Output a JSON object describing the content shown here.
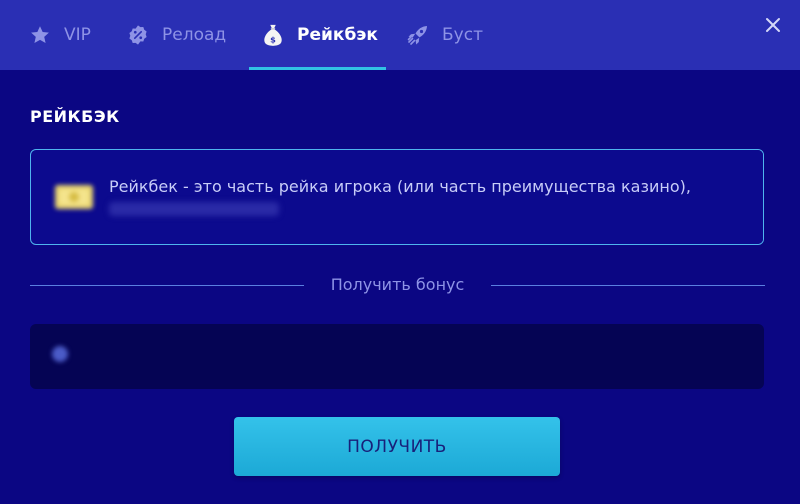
{
  "tabs": [
    {
      "label": "VIP",
      "icon": "star-icon"
    },
    {
      "label": "Релоад",
      "icon": "percent-badge-icon"
    },
    {
      "label": "Рейкбэк",
      "icon": "money-bag-icon",
      "active": true
    },
    {
      "label": "Буст",
      "icon": "rocket-icon"
    }
  ],
  "close_icon": "close-icon",
  "section": {
    "title": "РЕЙКБЭК"
  },
  "info": {
    "icon": "coin-icon",
    "text": "Рейкбек - это часть рейка игрока (или часть преимущества казино),"
  },
  "divider": {
    "label": "Получить бонус"
  },
  "button": {
    "label": "ПОЛУЧИТЬ"
  },
  "colors": {
    "background": "#0b0683",
    "tabbar": "#2a2fb4",
    "accent": "#31c3e4",
    "button": "#2bb8e2",
    "inactive_text": "#8e93e6"
  }
}
